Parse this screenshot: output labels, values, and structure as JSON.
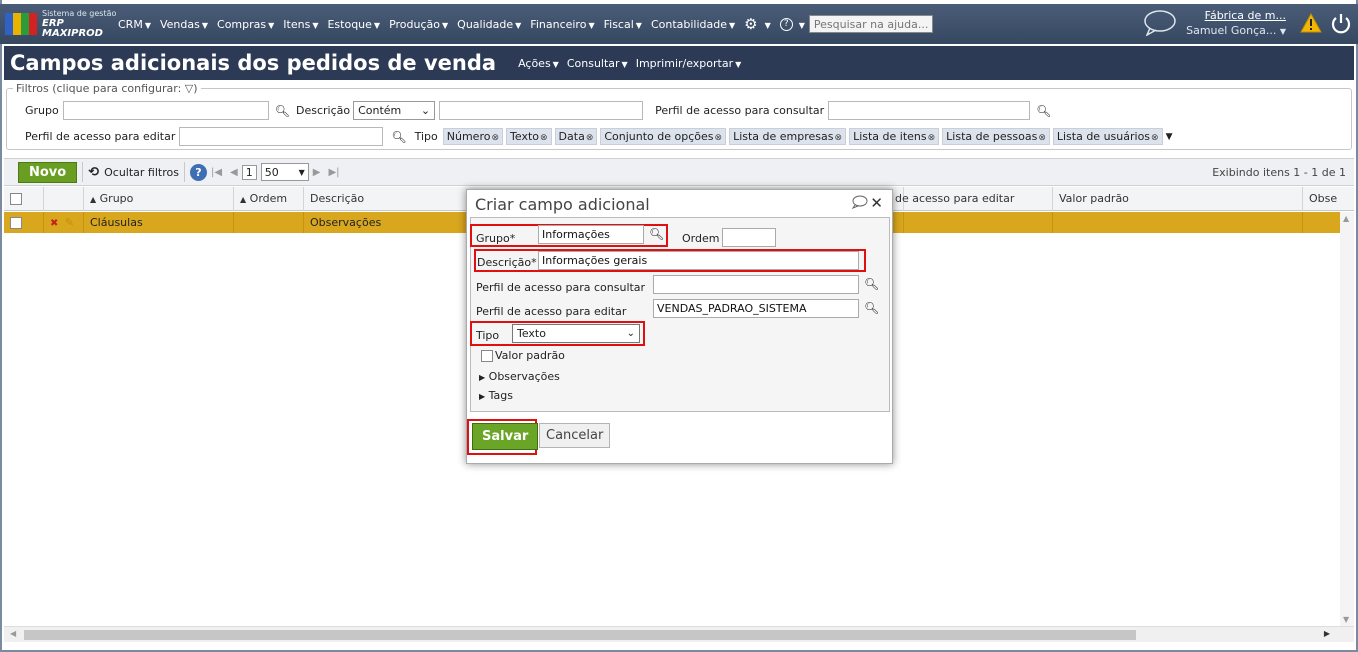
{
  "app": {
    "brand_line1": "Sistema de gestão",
    "brand_line2": "ERP MAXIPROD",
    "menu": [
      "CRM",
      "Vendas",
      "Compras",
      "Itens",
      "Estoque",
      "Produção",
      "Qualidade",
      "Financeiro",
      "Fiscal",
      "Contabilidade"
    ],
    "search_placeholder": "Pesquisar na ajuda...",
    "company": "Fábrica de m...",
    "user": "Samuel Gonça..."
  },
  "page": {
    "title": "Campos adicionais dos pedidos de venda",
    "title_menu": [
      "Ações",
      "Consultar",
      "Imprimir/exportar"
    ]
  },
  "filters": {
    "legend": "Filtros (clique para configurar:",
    "grupo_label": "Grupo",
    "descricao_label": "Descrição",
    "descricao_mode": "Contém",
    "perfil_consultar_label": "Perfil de acesso para consultar",
    "perfil_editar_label": "Perfil de acesso para editar",
    "tipo_label": "Tipo",
    "tipo_chips": [
      "Número",
      "Texto",
      "Data",
      "Conjunto de opções",
      "Lista de empresas",
      "Lista de itens",
      "Lista de pessoas",
      "Lista de usuários"
    ]
  },
  "toolbar": {
    "novo": "Novo",
    "ocultar_filtros": "Ocultar filtros",
    "page": "1",
    "per_page": "50",
    "showing": "Exibindo itens 1 - 1 de 1"
  },
  "grid": {
    "headers": {
      "grupo": "Grupo",
      "ordem": "Ordem",
      "descricao": "Descrição",
      "perfil_editar": "de acesso para editar",
      "valor_padrao": "Valor padrão",
      "obs": "Obse"
    },
    "rows": [
      {
        "grupo": "Cláusulas",
        "descricao": "Observações"
      }
    ]
  },
  "dialog": {
    "title": "Criar campo adicional",
    "grupo_label": "Grupo*",
    "grupo_value": "Informações",
    "ordem_label": "Ordem",
    "descricao_label": "Descrição*",
    "descricao_value": "Informações gerais",
    "perfil_consultar_label": "Perfil de acesso para consultar",
    "perfil_editar_label": "Perfil de acesso para editar",
    "perfil_editar_value": "VENDAS_PADRAO_SISTEMA",
    "tipo_label": "Tipo",
    "tipo_value": "Texto",
    "valor_padrao_label": "Valor padrão",
    "observacoes_label": "Observações",
    "tags_label": "Tags",
    "salvar": "Salvar",
    "cancelar": "Cancelar"
  },
  "colors": {
    "topbar": "#3f5270",
    "titlebar": "#2c3a55",
    "selected_row": "#d9a71d",
    "primary_button": "#6ba528",
    "highlight": "#e01010"
  }
}
